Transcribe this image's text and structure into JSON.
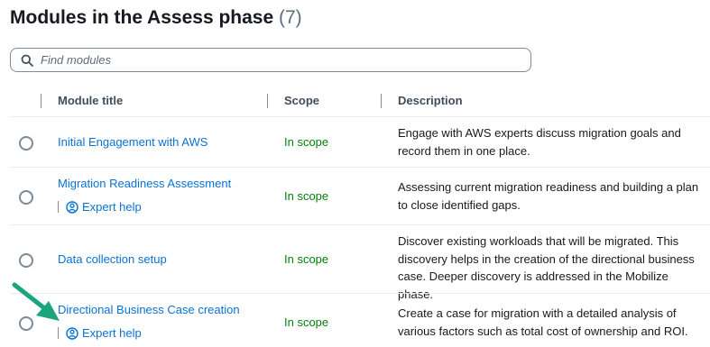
{
  "heading": {
    "title": "Modules in the Assess phase",
    "count": "(7)"
  },
  "search": {
    "placeholder": "Find modules"
  },
  "columns": {
    "title": "Module title",
    "scope": "Scope",
    "description": "Description"
  },
  "rows": [
    {
      "title": "Initial Engagement with AWS",
      "expert_help": "",
      "scope": "In scope",
      "description": "Engage with AWS experts discuss migration goals and record them in one place."
    },
    {
      "title": "Migration Readiness Assessment",
      "expert_help": "Expert help",
      "scope": "In scope",
      "description": "Assessing current migration readiness and building a plan to close identified gaps."
    },
    {
      "title": "Data collection setup",
      "expert_help": "",
      "scope": "In scope",
      "description": "Discover existing workloads that will be migrated. This discovery helps in the creation of the directional business case. Deeper discovery is addressed in the Mobilize phase."
    },
    {
      "title": "Directional Business Case creation",
      "expert_help": "Expert help",
      "scope": "In scope",
      "description": "Create a case for migration with a detailed analysis of various factors such as total cost of ownership and ROI."
    }
  ],
  "colors": {
    "link": "#0972d3",
    "in_scope": "#037f0c",
    "annotation_arrow": "#1aa57f"
  },
  "icons": {
    "search": "search-icon",
    "expert": "expert-help-icon",
    "annotation": "pointer-arrow-icon"
  }
}
